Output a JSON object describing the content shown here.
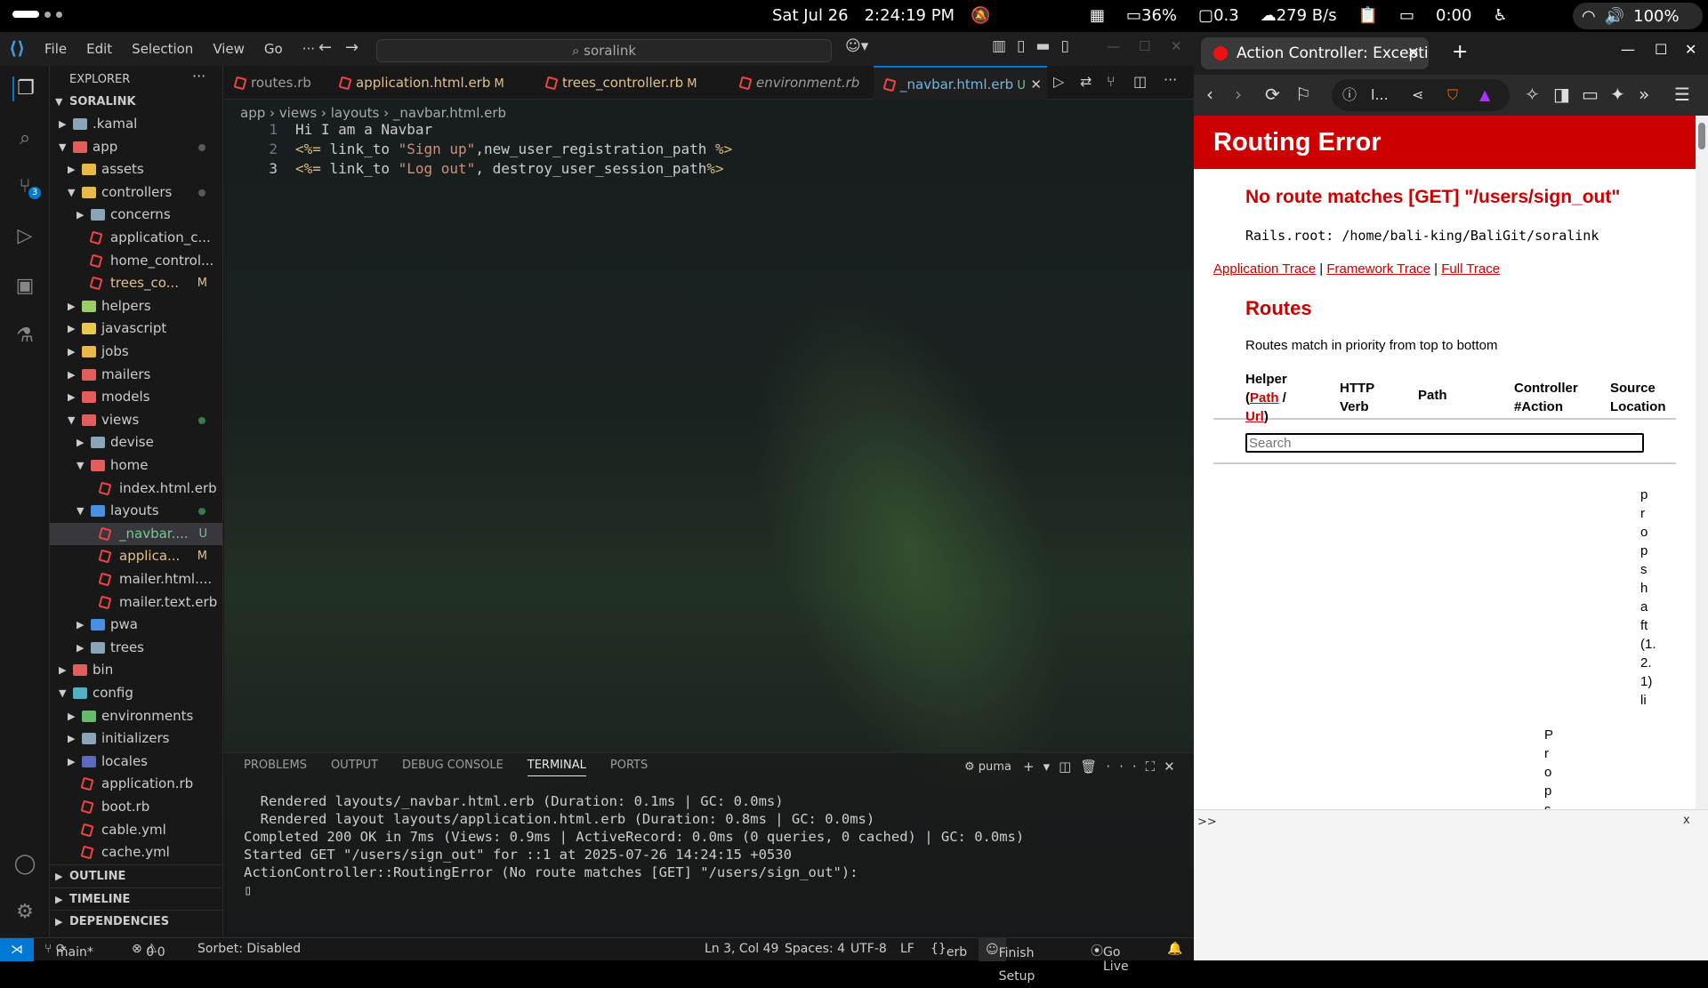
{
  "topbar": {
    "date": "Sat Jul 26",
    "time": "2:24:19 PM",
    "cpu": "36%",
    "load": "0.3",
    "net": "279 B/s",
    "timer": "0:00",
    "battery": "100%"
  },
  "vscode": {
    "menu": [
      "File",
      "Edit",
      "Selection",
      "View",
      "Go",
      "···"
    ],
    "search": "soralink",
    "explorer_title": "EXPLORER",
    "project": "SORALINK",
    "tree": [
      {
        "label": ".kamal",
        "depth": 1,
        "type": "folder",
        "open": false,
        "color": "#8aa4b8"
      },
      {
        "label": "app",
        "depth": 1,
        "type": "folder",
        "open": true,
        "color": "#e35d5d",
        "dot": true
      },
      {
        "label": "assets",
        "depth": 2,
        "type": "folder",
        "open": false,
        "color": "#e8b84a"
      },
      {
        "label": "controllers",
        "depth": 2,
        "type": "folder",
        "open": true,
        "color": "#e8b84a",
        "dot": true
      },
      {
        "label": "concerns",
        "depth": 3,
        "type": "folder",
        "open": false,
        "color": "#8aa4b8"
      },
      {
        "label": "application_c...",
        "depth": 3,
        "type": "file",
        "color": "#e44"
      },
      {
        "label": "home_control...",
        "depth": 3,
        "type": "file",
        "color": "#e44"
      },
      {
        "label": "trees_co...",
        "depth": 3,
        "type": "file",
        "color": "#e44",
        "status": "M"
      },
      {
        "label": "helpers",
        "depth": 2,
        "type": "folder",
        "open": false,
        "color": "#9ccc65"
      },
      {
        "label": "javascript",
        "depth": 2,
        "type": "folder",
        "open": false,
        "color": "#e8c84a"
      },
      {
        "label": "jobs",
        "depth": 2,
        "type": "folder",
        "open": false,
        "color": "#e8b84a"
      },
      {
        "label": "mailers",
        "depth": 2,
        "type": "folder",
        "open": false,
        "color": "#e35d5d"
      },
      {
        "label": "models",
        "depth": 2,
        "type": "folder",
        "open": false,
        "color": "#e35d5d"
      },
      {
        "label": "views",
        "depth": 2,
        "type": "folder",
        "open": true,
        "color": "#e35d5d",
        "dot": true,
        "green": true
      },
      {
        "label": "devise",
        "depth": 3,
        "type": "folder",
        "open": false,
        "color": "#8aa4b8"
      },
      {
        "label": "home",
        "depth": 3,
        "type": "folder",
        "open": true,
        "color": "#e35d5d"
      },
      {
        "label": "index.html.erb",
        "depth": 4,
        "type": "file",
        "color": "#e44"
      },
      {
        "label": "layouts",
        "depth": 3,
        "type": "folder",
        "open": true,
        "color": "#4a90e2",
        "dot": true,
        "blue": true
      },
      {
        "label": "_navbar....",
        "depth": 4,
        "type": "file",
        "color": "#e44",
        "status": "U",
        "selected": true
      },
      {
        "label": "applica...",
        "depth": 4,
        "type": "file",
        "color": "#e44",
        "status": "M"
      },
      {
        "label": "mailer.html....",
        "depth": 4,
        "type": "file",
        "color": "#e44"
      },
      {
        "label": "mailer.text.erb",
        "depth": 4,
        "type": "file",
        "color": "#e44"
      },
      {
        "label": "pwa",
        "depth": 3,
        "type": "folder",
        "open": false,
        "color": "#4a90e2"
      },
      {
        "label": "trees",
        "depth": 3,
        "type": "folder",
        "open": false,
        "color": "#8aa4b8"
      },
      {
        "label": "bin",
        "depth": 1,
        "type": "folder",
        "open": false,
        "color": "#e35d5d"
      },
      {
        "label": "config",
        "depth": 1,
        "type": "folder",
        "open": true,
        "color": "#4fb0c6"
      },
      {
        "label": "environments",
        "depth": 2,
        "type": "folder",
        "open": false,
        "color": "#66bb6a"
      },
      {
        "label": "initializers",
        "depth": 2,
        "type": "folder",
        "open": false,
        "color": "#8aa4b8"
      },
      {
        "label": "locales",
        "depth": 2,
        "type": "folder",
        "open": false,
        "color": "#5c6bc0"
      },
      {
        "label": "application.rb",
        "depth": 2,
        "type": "file",
        "color": "#e44"
      },
      {
        "label": "boot.rb",
        "depth": 2,
        "type": "file",
        "color": "#e44"
      },
      {
        "label": "cable.yml",
        "depth": 2,
        "type": "file",
        "color": "#e44"
      },
      {
        "label": "cache.yml",
        "depth": 2,
        "type": "file",
        "color": "#e44"
      }
    ],
    "sections": [
      "OUTLINE",
      "TIMELINE",
      "DEPENDENCIES"
    ],
    "tabs": [
      {
        "label": "routes.rb",
        "status": ""
      },
      {
        "label": "application.html.erb",
        "status": "M"
      },
      {
        "label": "trees_controller.rb",
        "status": "M"
      },
      {
        "label": "environment.rb",
        "status": ""
      },
      {
        "label": "_navbar.html.erb",
        "status": "U",
        "active": true
      }
    ],
    "breadcrumb": [
      "app",
      "views",
      "layouts",
      "_navbar.html.erb"
    ],
    "code": [
      {
        "n": "1",
        "parts": [
          [
            "t",
            "Hi I am a Navbar"
          ]
        ]
      },
      {
        "n": "2",
        "parts": [
          [
            "e",
            "<%="
          ],
          [
            "t",
            " link_to "
          ],
          [
            "s",
            "\"Sign up\""
          ],
          [
            "t",
            ",new_user_registration_path "
          ],
          [
            "e",
            "%>"
          ]
        ]
      },
      {
        "n": "3",
        "parts": [
          [
            "e",
            "<%="
          ],
          [
            "t",
            " link_to "
          ],
          [
            "s",
            "\"Log out\""
          ],
          [
            "t",
            ", destroy_user_session_path"
          ],
          [
            "e",
            "%>"
          ]
        ]
      }
    ],
    "panel_tabs": [
      "PROBLEMS",
      "OUTPUT",
      "DEBUG CONSOLE",
      "TERMINAL",
      "PORTS"
    ],
    "terminal_name": "puma",
    "terminal": [
      "  Rendered layouts/_navbar.html.erb (Duration: 0.1ms | GC: 0.0ms)",
      "  Rendered layout layouts/application.html.erb (Duration: 0.8ms | GC: 0.0ms)",
      "Completed 200 OK in 7ms (Views: 0.9ms | ActiveRecord: 0.0ms (0 queries, 0 cached) | GC: 0.0ms)",
      "",
      "",
      "Started GET \"/users/sign_out\" for ::1 at 2025-07-26 14:24:15 +0530",
      "",
      "ActionController::RoutingError (No route matches [GET] \"/users/sign_out\"):",
      "",
      "▯"
    ],
    "status": {
      "branch": "main*",
      "errors": "0",
      "warnings": "0",
      "sorbet": "Sorbet: Disabled",
      "position": "Ln 3, Col 49",
      "spaces": "Spaces: 4",
      "encoding": "UTF-8",
      "eol": "LF",
      "lang": "erb",
      "setup": "Finish Setup",
      "golive": "Go Live"
    }
  },
  "browser": {
    "tab_title": "Action Controller: Excepti",
    "url": "l...",
    "error_title": "Routing Error",
    "message": "No route matches [GET] \"/users/sign_out\"",
    "rails_root_label": "Rails.root:",
    "rails_root": "/home/bali-king/BaliGit/soralink",
    "traces": [
      "Application Trace",
      "Framework Trace",
      "Full Trace"
    ],
    "routes_heading": "Routes",
    "routes_desc": "Routes match in priority from top to bottom",
    "table_headers": {
      "helper_a": "Helper",
      "helper_path": "Path",
      "helper_url": "Url",
      "verb": "HTTP Verb",
      "path": "Path",
      "action": "Controller#Action",
      "source": "Source Location"
    },
    "search_placeholder": "Search",
    "vertical_a": "Props",
    "vertical_b": "propshaft (1.2.1) li",
    "bottom_prompt": ">>",
    "bottom_close": "x"
  }
}
